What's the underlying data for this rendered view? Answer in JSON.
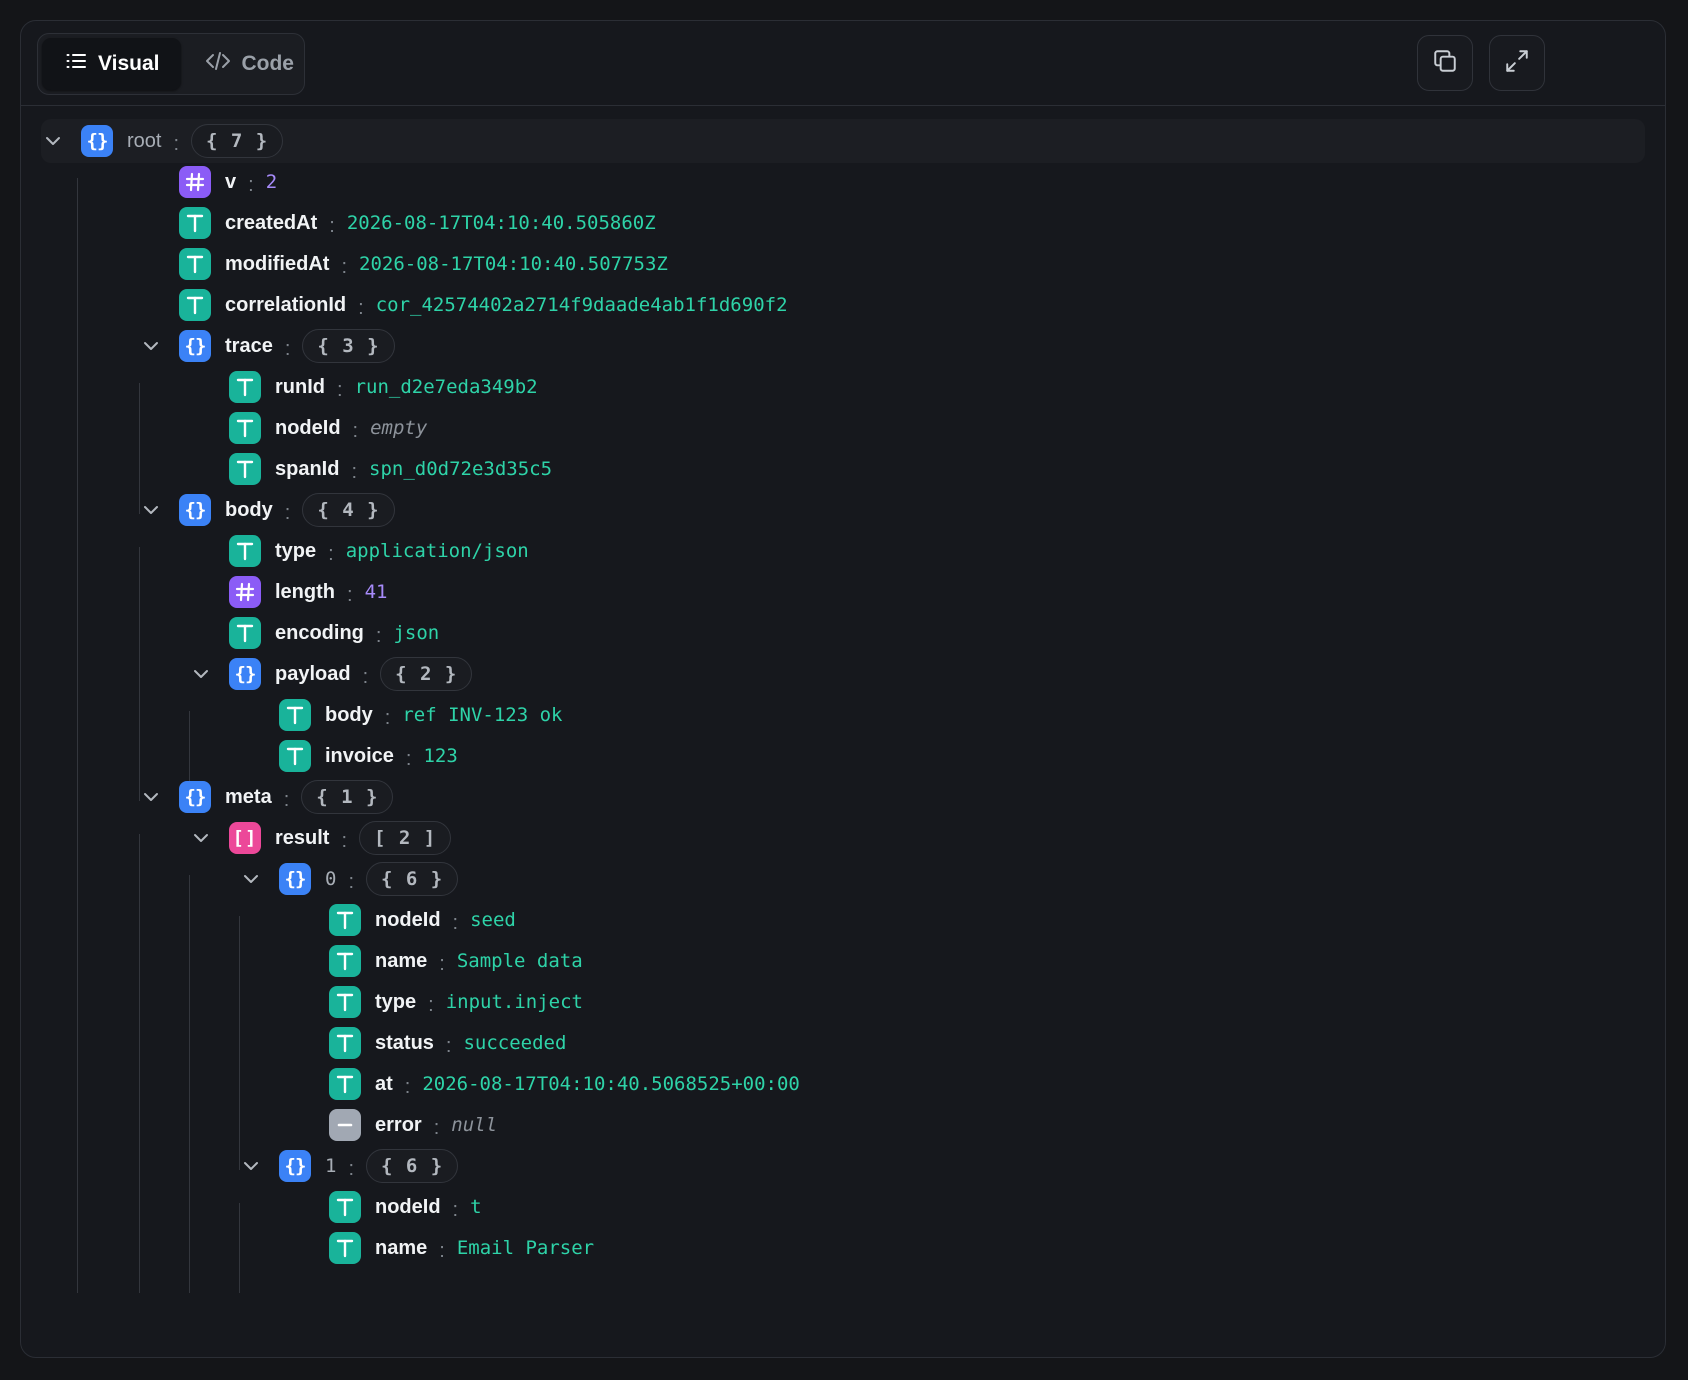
{
  "header": {
    "tabs": [
      {
        "label": "Visual",
        "icon": "list-icon",
        "active": true
      },
      {
        "label": "Code",
        "icon": "code-icon",
        "active": false
      }
    ],
    "actions": [
      {
        "name": "copy-button",
        "icon": "copy-icon"
      },
      {
        "name": "expand-button",
        "icon": "expand-icon"
      }
    ]
  },
  "colors": {
    "string": "#19b39a",
    "number": "#8b5cf6",
    "object": "#3b82f6",
    "array": "#ec4899",
    "null": "#a1a8b3"
  },
  "tree": [
    {
      "depth": 0,
      "kind": "obj",
      "key": "root",
      "count": "{ 7 }",
      "expandable": true,
      "highlight": true,
      "keyStyle": "root"
    },
    {
      "depth": 1,
      "kind": "num",
      "key": "v",
      "value": "2"
    },
    {
      "depth": 1,
      "kind": "str",
      "key": "createdAt",
      "value": "2026-08-17T04:10:40.505860Z"
    },
    {
      "depth": 1,
      "kind": "str",
      "key": "modifiedAt",
      "value": "2026-08-17T04:10:40.507753Z"
    },
    {
      "depth": 1,
      "kind": "str",
      "key": "correlationId",
      "value": "cor_42574402a2714f9daade4ab1f1d690f2"
    },
    {
      "depth": 1,
      "kind": "obj",
      "key": "trace",
      "count": "{ 3 }",
      "expandable": true
    },
    {
      "depth": 2,
      "kind": "str",
      "key": "runId",
      "value": "run_d2e7eda349b2"
    },
    {
      "depth": 2,
      "kind": "str",
      "key": "nodeId",
      "value": "empty",
      "empty": true
    },
    {
      "depth": 2,
      "kind": "str",
      "key": "spanId",
      "value": "spn_d0d72e3d35c5"
    },
    {
      "depth": 1,
      "kind": "obj",
      "key": "body",
      "count": "{ 4 }",
      "expandable": true
    },
    {
      "depth": 2,
      "kind": "str",
      "key": "type",
      "value": "application/json"
    },
    {
      "depth": 2,
      "kind": "num",
      "key": "length",
      "value": "41"
    },
    {
      "depth": 2,
      "kind": "str",
      "key": "encoding",
      "value": "json"
    },
    {
      "depth": 2,
      "kind": "obj",
      "key": "payload",
      "count": "{ 2 }",
      "expandable": true
    },
    {
      "depth": 3,
      "kind": "str",
      "key": "body",
      "value": "ref INV-123 ok"
    },
    {
      "depth": 3,
      "kind": "str",
      "key": "invoice",
      "value": "123"
    },
    {
      "depth": 1,
      "kind": "obj",
      "key": "meta",
      "count": "{ 1 }",
      "expandable": true
    },
    {
      "depth": 2,
      "kind": "arr",
      "key": "result",
      "count": "[ 2 ]",
      "expandable": true
    },
    {
      "depth": 3,
      "kind": "obj",
      "key": "0",
      "count": "{ 6 }",
      "expandable": true,
      "keyStyle": "idx"
    },
    {
      "depth": 4,
      "kind": "str",
      "key": "nodeId",
      "value": "seed"
    },
    {
      "depth": 4,
      "kind": "str",
      "key": "name",
      "value": "Sample data"
    },
    {
      "depth": 4,
      "kind": "str",
      "key": "type",
      "value": "input.inject"
    },
    {
      "depth": 4,
      "kind": "str",
      "key": "status",
      "value": "succeeded"
    },
    {
      "depth": 4,
      "kind": "str",
      "key": "at",
      "value": "2026-08-17T04:10:40.5068525+00:00"
    },
    {
      "depth": 4,
      "kind": "nul",
      "key": "error",
      "value": "null",
      "empty": true
    },
    {
      "depth": 3,
      "kind": "obj",
      "key": "1",
      "count": "{ 6 }",
      "expandable": true,
      "keyStyle": "idx"
    },
    {
      "depth": 4,
      "kind": "str",
      "key": "nodeId",
      "value": "t"
    },
    {
      "depth": 4,
      "kind": "str",
      "key": "name",
      "value": "Email Parser"
    }
  ],
  "separator": ":"
}
